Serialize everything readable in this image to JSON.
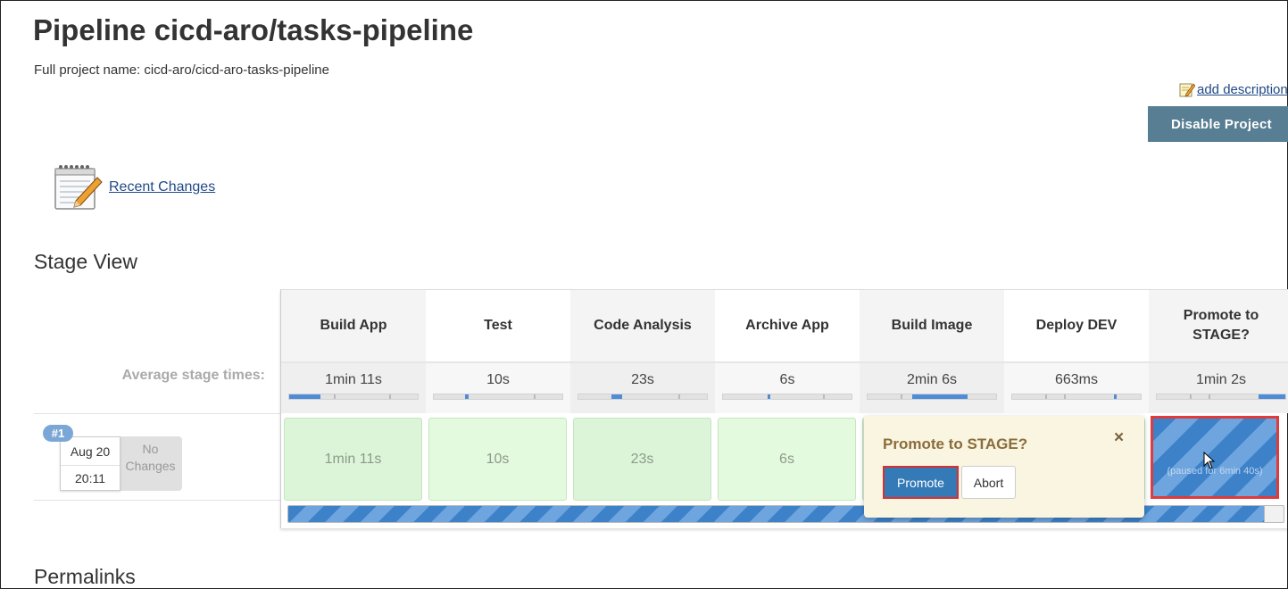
{
  "page": {
    "title": "Pipeline cicd-aro/tasks-pipeline",
    "full_project_name": "Full project name: cicd-aro/cicd-aro-tasks-pipeline",
    "add_description": "add description",
    "disable_button": "Disable Project",
    "recent_changes": "Recent Changes",
    "stage_view_heading": "Stage View",
    "permalinks_heading": "Permalinks"
  },
  "stage_view": {
    "average_label": "Average stage times:",
    "stages": [
      {
        "name": "Build App",
        "avg": "1min 11s",
        "run_time": "1min 11s",
        "avg_fill_fraction": 0.24
      },
      {
        "name": "Test",
        "avg": "10s",
        "run_time": "10s",
        "avg_fill_fraction": 0.03
      },
      {
        "name": "Code Analysis",
        "avg": "23s",
        "run_time": "23s",
        "avg_fill_fraction": 0.08
      },
      {
        "name": "Archive App",
        "avg": "6s",
        "run_time": "6s",
        "avg_fill_fraction": 0.02
      },
      {
        "name": "Build Image",
        "avg": "2min 6s",
        "run_time": "",
        "avg_fill_fraction": 0.43
      },
      {
        "name": "Deploy DEV",
        "avg": "663ms",
        "run_time": "",
        "avg_fill_fraction": 0.01
      },
      {
        "name": "Promote to STAGE?",
        "avg": "1min 2s",
        "run_time": "",
        "avg_fill_fraction": 0.21
      }
    ],
    "run": {
      "badge": "#1",
      "date": "Aug 20",
      "time": "20:11",
      "changes": "No Changes",
      "paused_label": "(paused for 6min 40s)",
      "progress_fraction": 0.98
    }
  },
  "popover": {
    "title": "Promote to STAGE?",
    "close": "×",
    "promote": "Promote",
    "abort": "Abort"
  },
  "colors": {
    "accent": "#337ab7",
    "success_cell": "#dcf5d8",
    "disable_button": "#587e93",
    "highlight_border": "#e03a3a",
    "popover_bg": "#faf5e1"
  }
}
